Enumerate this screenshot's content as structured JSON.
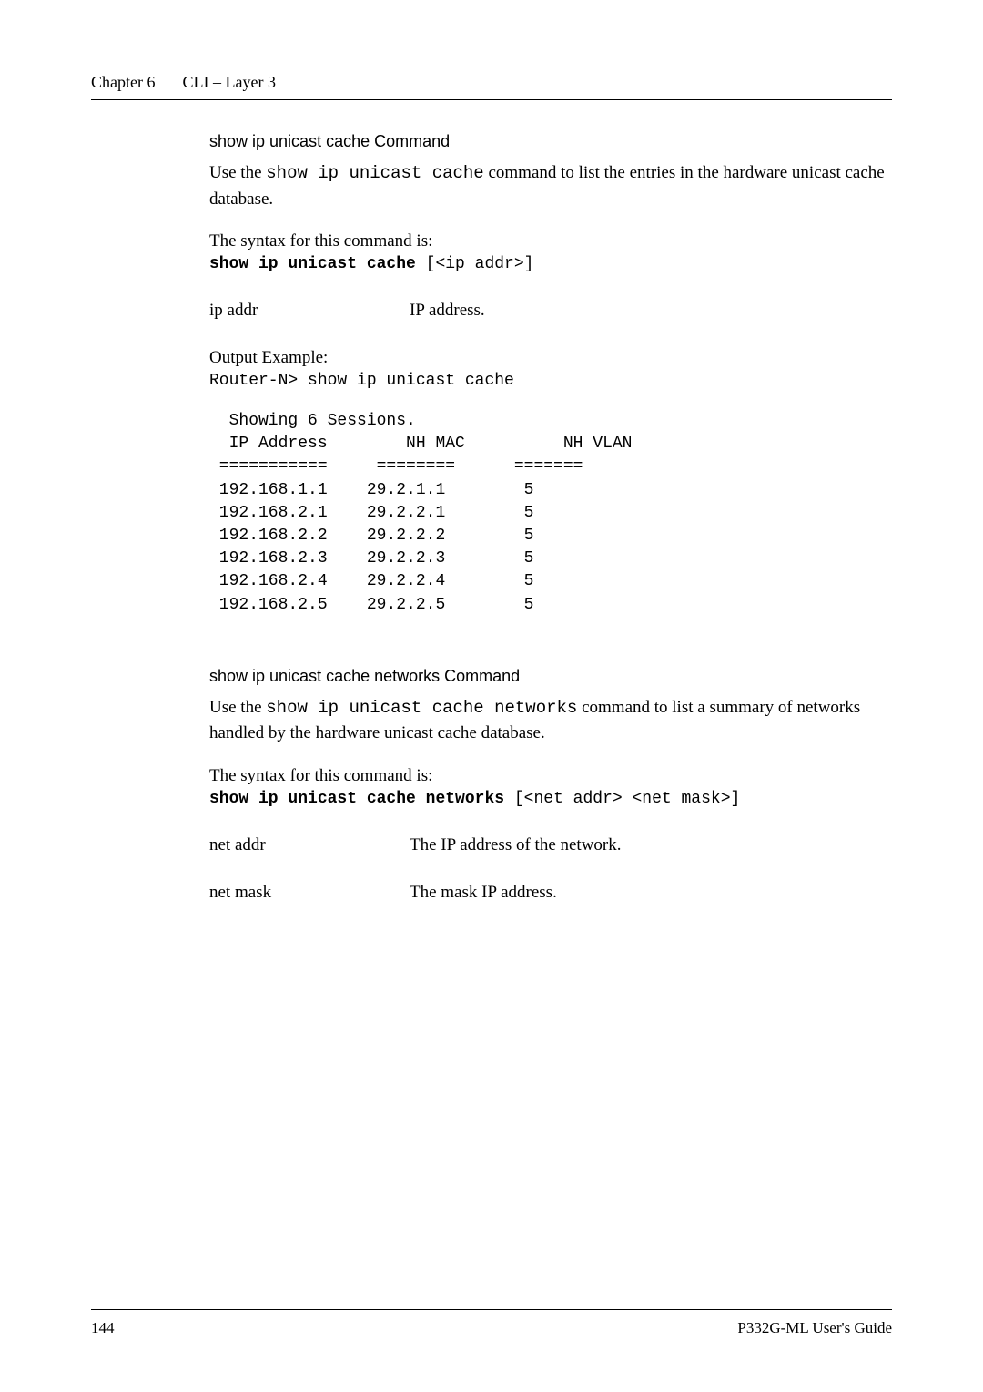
{
  "header": {
    "chapter_label": "Chapter 6",
    "chapter_title": "CLI – Layer 3"
  },
  "section1": {
    "heading": "show ip unicast cache Command",
    "intro_pre": "Use the ",
    "intro_mono": "show ip unicast cache",
    "intro_post": " command to list the entries in the hardware unicast cache database.",
    "syntax_intro": "The syntax for this command is:",
    "syntax_bold": "show ip unicast cache",
    "syntax_rest": " [<ip addr>]",
    "param_name": " ip addr",
    "param_desc": "IP address.",
    "example_label": "Output Example:",
    "example_cmd": "Router-N> show ip unicast cache",
    "output": "  Showing 6 Sessions.\n  IP Address        NH MAC          NH VLAN\n ===========     ========      =======\n 192.168.1.1    29.2.1.1        5\n 192.168.2.1    29.2.2.1        5\n 192.168.2.2    29.2.2.2        5\n 192.168.2.3    29.2.2.3        5\n 192.168.2.4    29.2.2.4        5\n 192.168.2.5    29.2.2.5        5"
  },
  "section2": {
    "heading": "show ip unicast cache networks Command",
    "intro_pre": "Use the ",
    "intro_mono": "show ip unicast cache networks",
    "intro_post": " command to list a summary of networks handled by the hardware unicast cache database.",
    "syntax_intro": "The syntax for this command is:",
    "syntax_bold": "show ip unicast cache networks",
    "syntax_rest": " [<net addr> <net mask>]",
    "param1_name": "net addr",
    "param1_desc": "The IP address of the network.",
    "param2_name": "net mask",
    "param2_desc": "The mask IP address."
  },
  "footer": {
    "page_number": "144",
    "guide_title": "P332G-ML User's Guide"
  }
}
